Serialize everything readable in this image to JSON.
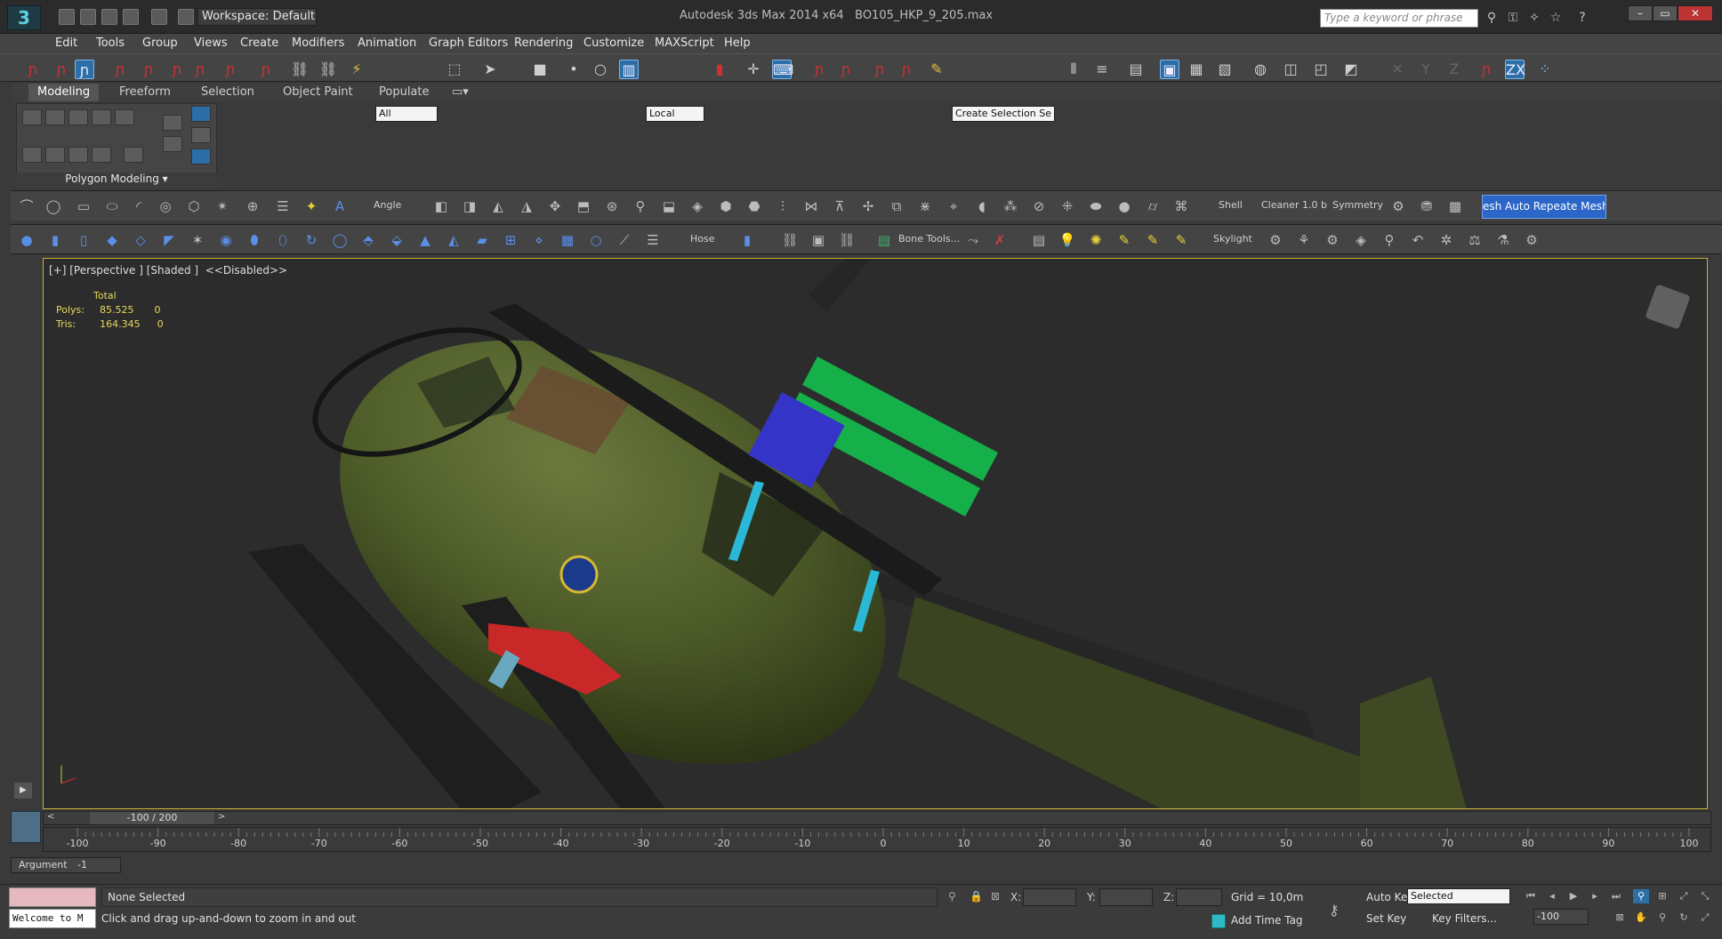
{
  "app": {
    "title": "Autodesk 3ds Max 2014 x64",
    "file": "BO105_HKP_9_205.max",
    "workspace": "Workspace: Default",
    "search_placeholder": "Type a keyword or phrase"
  },
  "menu": [
    "Edit",
    "Tools",
    "Group",
    "Views",
    "Create",
    "Modifiers",
    "Animation",
    "Graph Editors",
    "Rendering",
    "Customize",
    "MAXScript",
    "Help"
  ],
  "toolbar": {
    "filter_value": "All",
    "coord_system": "Local",
    "selection_set_placeholder": "Create Selection Se"
  },
  "ribbon": {
    "tabs": [
      "Modeling",
      "Freeform",
      "Selection",
      "Object Paint",
      "Populate"
    ],
    "active_tab": "Modeling",
    "panel_label": "Polygon Modeling"
  },
  "command_row1": {
    "angle_label": "Angle",
    "shell_label": "Shell",
    "cleaner_label": "Cleaner 1.0 b",
    "symmetry_label": "Symmetry",
    "highlight_label": "esh Auto Repeate Mesh Insp"
  },
  "command_row2": {
    "hose_label": "Hose",
    "bone_tools_label": "Bone Tools...",
    "skylight_label": "Skylight"
  },
  "viewport": {
    "label": "[+] [Perspective ] [Shaded ]  <<Disabled>>",
    "stats": {
      "header": "Total",
      "polys_label": "Polys:",
      "polys_value": "85.525",
      "polys_sel": "0",
      "tris_label": "Tris:",
      "tris_value": "164.345",
      "tris_sel": "0"
    }
  },
  "timeline": {
    "slider_text": "-100 / 200",
    "ticks": [
      "-100",
      "-90",
      "-80",
      "-70",
      "-60",
      "-50",
      "-40",
      "-30",
      "-20",
      "-10",
      "0",
      "10",
      "20",
      "30",
      "40",
      "50",
      "60",
      "70",
      "80",
      "90",
      "100"
    ]
  },
  "argument": {
    "label": "Argument",
    "value": "-1"
  },
  "status": {
    "selection": "None Selected",
    "prompt": "Click and drag up-and-down to zoom in and out",
    "welcome": "Welcome to M",
    "x_label": "X:",
    "y_label": "Y:",
    "z_label": "Z:",
    "grid": "Grid = 10,0m",
    "add_time_tag": "Add Time Tag",
    "auto_key": "Auto Key",
    "set_key": "Set Key",
    "key_mode_value": "Selected",
    "key_filters": "Key Filters...",
    "current_frame": "-100"
  }
}
